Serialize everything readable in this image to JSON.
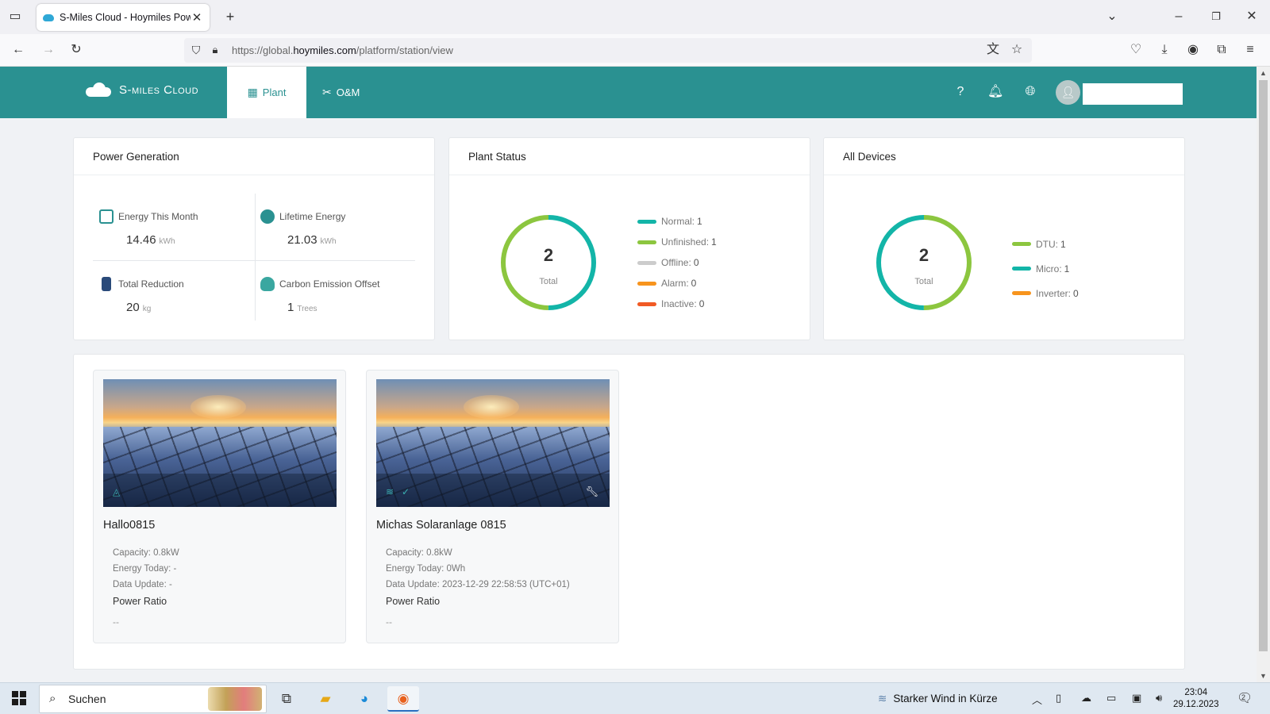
{
  "browser": {
    "tab_title": "S-Miles Cloud - Hoymiles Powe",
    "url_prefix": "https://global.",
    "url_domain": "hoymiles.com",
    "url_path": "/platform/station/view"
  },
  "app": {
    "brand": "S-miles Cloud",
    "nav": {
      "plant": "Plant",
      "om": "O&M"
    }
  },
  "power_generation": {
    "title": "Power Generation",
    "energy_month": {
      "label": "Energy This Month",
      "value": "14.46",
      "unit": "kWh"
    },
    "lifetime": {
      "label": "Lifetime Energy",
      "value": "21.03",
      "unit": "kWh"
    },
    "reduction": {
      "label": "Total Reduction",
      "value": "20",
      "unit": "kg"
    },
    "carbon": {
      "label": "Carbon Emission Offset",
      "value": "1",
      "unit": "Trees"
    }
  },
  "plant_status": {
    "title": "Plant Status",
    "total": "2",
    "total_label": "Total",
    "legend": [
      {
        "label": "Normal:",
        "value": "1",
        "color": "#13b5a8"
      },
      {
        "label": "Unfinished:",
        "value": "1",
        "color": "#8cc63f"
      },
      {
        "label": "Offline:",
        "value": "0",
        "color": "#cccccc"
      },
      {
        "label": "Alarm:",
        "value": "0",
        "color": "#f7941d"
      },
      {
        "label": "Inactive:",
        "value": "0",
        "color": "#f15a24"
      }
    ]
  },
  "all_devices": {
    "title": "All Devices",
    "total": "2",
    "total_label": "Total",
    "legend": [
      {
        "label": "DTU:",
        "value": "1",
        "color": "#8cc63f"
      },
      {
        "label": "Micro:",
        "value": "1",
        "color": "#13b5a8"
      },
      {
        "label": "Inverter:",
        "value": "0",
        "color": "#f7941d"
      }
    ]
  },
  "plants": [
    {
      "name": "Hallo0815",
      "capacity": "Capacity: 0.8kW",
      "energy_today": "Energy Today: -",
      "data_update": "Data Update: -",
      "ratio_label": "Power Ratio",
      "ratio_value": "--"
    },
    {
      "name": "Michas Solaranlage 0815",
      "capacity": "Capacity: 0.8kW",
      "energy_today": "Energy Today: 0Wh",
      "data_update": "Data Update: 2023-12-29 22:58:53 (UTC+01)",
      "ratio_label": "Power Ratio",
      "ratio_value": "--"
    }
  ],
  "taskbar": {
    "search_label": "Suchen",
    "weather": "Starker Wind in Kürze",
    "time": "23:04",
    "date": "29.12.2023",
    "notifications": "2"
  }
}
